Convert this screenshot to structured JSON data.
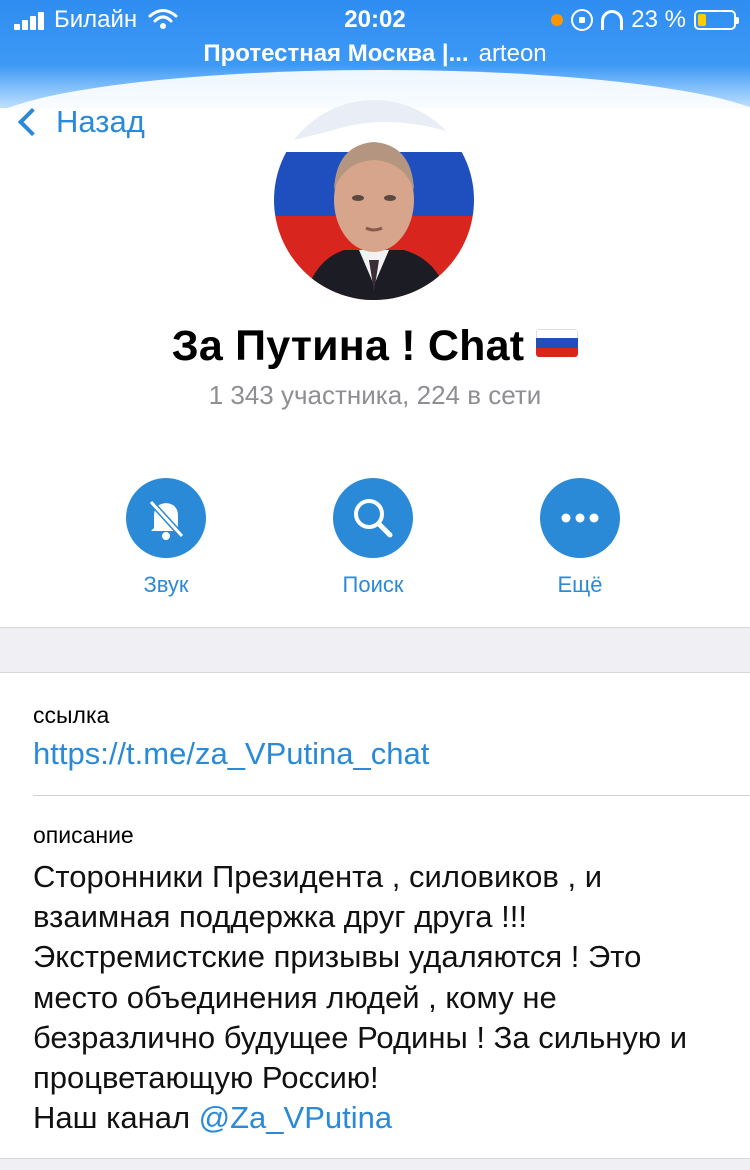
{
  "status_bar": {
    "carrier": "Билайн",
    "time": "20:02",
    "battery_percent": "23 %",
    "battery_level": 0.23,
    "colors": {
      "dot": "#ff9500",
      "battery": "#ffcc00"
    }
  },
  "banner": {
    "group_name": "Протестная Москва |...",
    "user": "arteon"
  },
  "nav": {
    "back_label": "Назад"
  },
  "chat": {
    "title": "За Путина ! Chat",
    "flag": "russian-flag-icon",
    "members": "1 343 участника, 224 в сети"
  },
  "actions": [
    {
      "label": "Звук",
      "icon": "bell-slash-icon"
    },
    {
      "label": "Поиск",
      "icon": "search-icon"
    },
    {
      "label": "Ещё",
      "icon": "more-dots-icon"
    }
  ],
  "info": {
    "link_label": "ссылка",
    "link": "https://t.me/za_VPutina_chat",
    "description_label": "описание",
    "description_text": "Сторонники Президента , силовиков , и взаимная поддержка друг друга !!! Экстремистские призывы удаляются ! Это место объединения людей , кому не безразлично будущее Родины ! За сильную и процветающую Россию!",
    "description_channel_prefix": "Наш канал ",
    "description_channel": "@Za_VPutina"
  },
  "accent_color": "#2a8ad8"
}
